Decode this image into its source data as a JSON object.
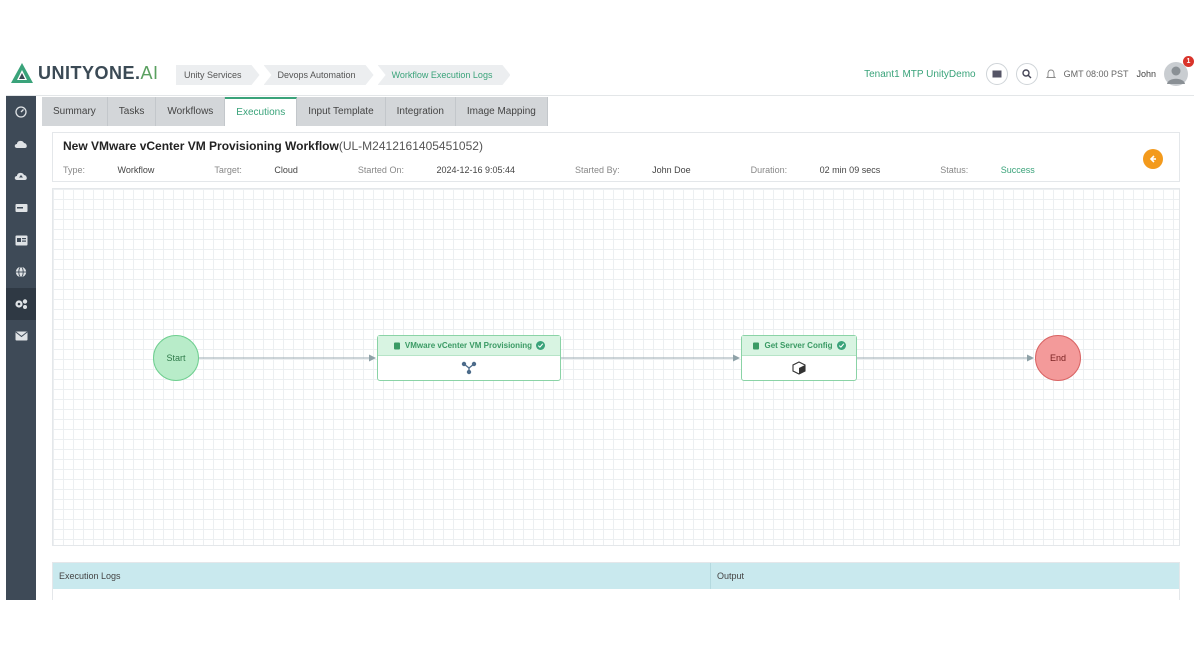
{
  "brand": {
    "name": "UNITYONE.",
    "suffix": "AI"
  },
  "breadcrumb": [
    "Unity Services",
    "Devops Automation",
    "Workflow Execution Logs"
  ],
  "topbar": {
    "tenant": "Tenant1 MTP UnityDemo",
    "timezone": "GMT 08:00 PST",
    "user": "John",
    "notifications": "1"
  },
  "tabs": [
    "Summary",
    "Tasks",
    "Workflows",
    "Executions",
    "Input Template",
    "Integration",
    "Image Mapping"
  ],
  "active_tab": "Executions",
  "workflow": {
    "title": "New VMware vCenter VM Provisioning Workflow",
    "id": "(UL-M2412161405451052)",
    "type_label": "Type:",
    "type": "Workflow",
    "target_label": "Target:",
    "target": "Cloud",
    "started_on_label": "Started On:",
    "started_on": "2024-12-16 9:05:44",
    "started_by_label": "Started By:",
    "started_by": "John Doe",
    "duration_label": "Duration:",
    "duration": "02 min 09 secs",
    "status_label": "Status:",
    "status": "Success"
  },
  "flow": {
    "start": "Start",
    "end": "End",
    "tasks": [
      {
        "label": "VMware vCenter VM Provisioning",
        "icon": "vmware-icon",
        "status": "success"
      },
      {
        "label": "Get Server Config",
        "icon": "cube-icon",
        "status": "success"
      }
    ]
  },
  "logs": {
    "col1": "Execution Logs",
    "col2": "Output"
  },
  "colors": {
    "accent": "#3aa37a",
    "sidebar": "#3e4a57",
    "orange": "#f39a1c",
    "start": "#b8ecc9",
    "end": "#f39a9a"
  }
}
